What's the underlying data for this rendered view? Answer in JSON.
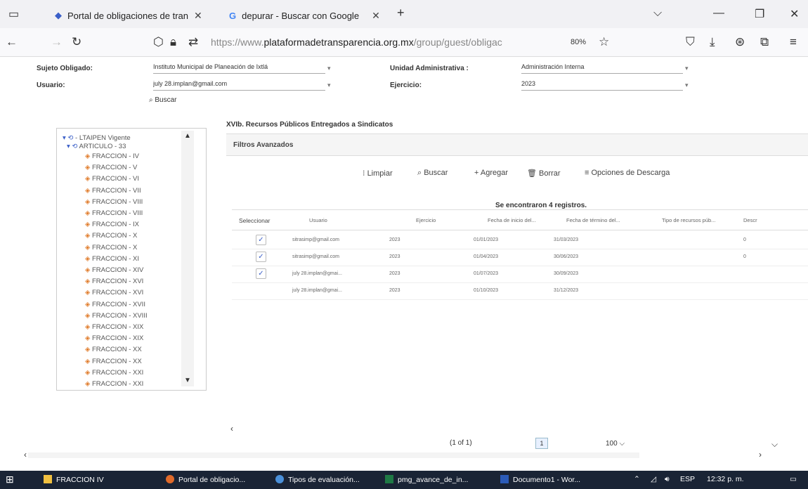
{
  "browser": {
    "tabs": [
      {
        "title": "Portal de obligaciones de tran"
      },
      {
        "title": "depurar - Buscar con Google"
      }
    ],
    "url_prefix": "https://www.",
    "url_domain": "plataformadetransparencia.org.mx",
    "url_suffix": "/group/guest/obligac",
    "zoom": "80%"
  },
  "form": {
    "sujeto_label": "Sujeto Obligado:",
    "sujeto_value": "Instituto Municipal de Planeación de Ixtlá",
    "usuario_label": "Usuario:",
    "usuario_value": "july 28.implan@gmail.com",
    "unidad_label": "Unidad Administrativa :",
    "unidad_value": "Administración Interna",
    "ejercicio_label": "Ejercicio:",
    "ejercicio_value": "2023",
    "buscar": "Buscar"
  },
  "tree": {
    "root": "LTAIPEN Vigente",
    "article": "ARTICULO - 33",
    "items": [
      "FRACCION - IV",
      "FRACCION - V",
      "FRACCION - VI",
      "FRACCION - VII",
      "FRACCION - VIII",
      "FRACCION - VIII",
      "FRACCION - IX",
      "FRACCION - X",
      "FRACCION - X",
      "FRACCION - XI",
      "FRACCION - XIV",
      "FRACCION - XVI",
      "FRACCION - XVI",
      "FRACCION - XVII",
      "FRACCION - XVIII",
      "FRACCION - XIX",
      "FRACCION - XIX",
      "FRACCION - XX",
      "FRACCION - XX",
      "FRACCION - XXI",
      "FRACCION - XXI"
    ]
  },
  "content": {
    "title": "XVIb. Recursos Públicos Entregados a Sindicatos",
    "filtros": "Filtros Avanzados",
    "actions": {
      "limpiar": "Limpiar",
      "buscar": "Buscar",
      "agregar": "Agregar",
      "borrar": "Borrar",
      "descarga": "Opciones de Descarga"
    },
    "found": "Se encontraron 4 registros.",
    "columns": [
      "Seleccionar",
      "Usuario",
      "Ejercicio",
      "Fecha de inicio del...",
      "Fecha de término del...",
      "Tipo de recursos púb...",
      "Descr"
    ],
    "rows": [
      {
        "checked": true,
        "usuario": "sitrasimp@gmail.com",
        "ejercicio": "2023",
        "inicio": "01/01/2023",
        "termino": "31/03/2023",
        "extra": "0"
      },
      {
        "checked": true,
        "usuario": "sitrasimp@gmail.com",
        "ejercicio": "2023",
        "inicio": "01/04/2023",
        "termino": "30/06/2023",
        "extra": "0"
      },
      {
        "checked": true,
        "usuario": "july 28.implan@gmai...",
        "ejercicio": "2023",
        "inicio": "01/07/2023",
        "termino": "30/09/2023",
        "extra": ""
      },
      {
        "checked": false,
        "usuario": "july 28.implan@gmai...",
        "ejercicio": "2023",
        "inicio": "01/10/2023",
        "termino": "31/12/2023",
        "extra": ""
      }
    ],
    "pager": "(1 of 1)",
    "page": "1",
    "per_page": "100"
  },
  "taskbar": {
    "items": [
      "FRACCION IV",
      "Portal de obligacio...",
      "Tipos de evaluación...",
      "pmg_avance_de_in...",
      "Documento1 - Wor..."
    ],
    "lang": "ESP",
    "time": "12:32 p. m."
  }
}
